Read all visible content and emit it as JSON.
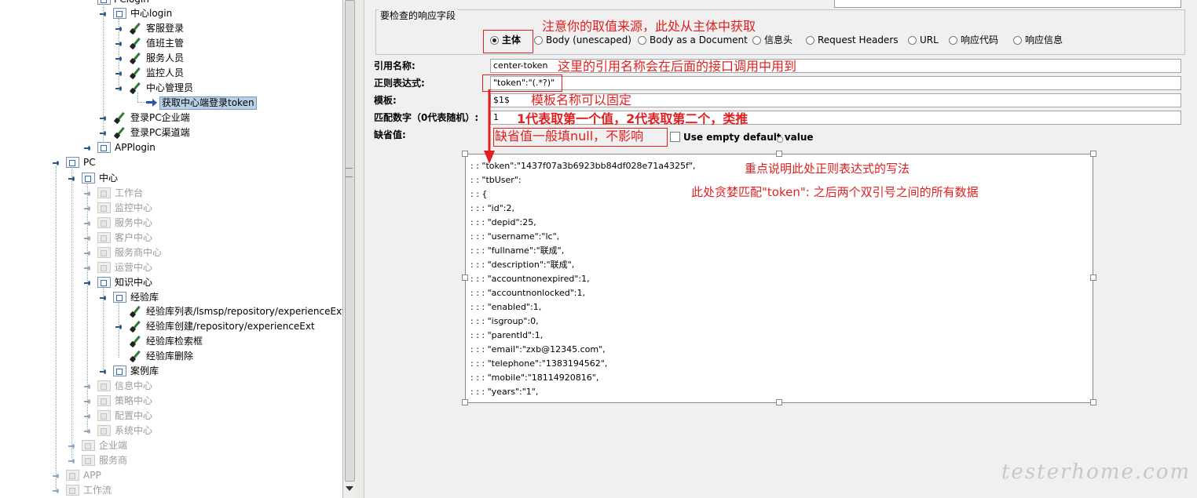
{
  "tree": {
    "nodes": [
      {
        "label": "PClogin",
        "dim": false
      },
      {
        "label": "中心login",
        "dim": false
      },
      {
        "label": "客服登录",
        "dim": false
      },
      {
        "label": "值班主管",
        "dim": false
      },
      {
        "label": "服务人员",
        "dim": false
      },
      {
        "label": "监控人员",
        "dim": false
      },
      {
        "label": "中心管理员",
        "dim": false
      },
      {
        "label": "获取中心端登录token",
        "dim": false,
        "selected": true
      },
      {
        "label": "登录PC企业端",
        "dim": false
      },
      {
        "label": "登录PC渠道端",
        "dim": false
      },
      {
        "label": "APPlogin",
        "dim": false
      },
      {
        "label": "PC",
        "dim": false
      },
      {
        "label": "中心",
        "dim": false
      },
      {
        "label": "工作台",
        "dim": true
      },
      {
        "label": "监控中心",
        "dim": true
      },
      {
        "label": "服务中心",
        "dim": true
      },
      {
        "label": "客户中心",
        "dim": true
      },
      {
        "label": "服务商中心",
        "dim": true
      },
      {
        "label": "运营中心",
        "dim": true
      },
      {
        "label": "知识中心",
        "dim": false
      },
      {
        "label": "经验库",
        "dim": false
      },
      {
        "label": "经验库列表/lsmsp/repository/experienceExt",
        "dim": false
      },
      {
        "label": "经验库创建/repository/experienceExt",
        "dim": false
      },
      {
        "label": "经验库检索框",
        "dim": false
      },
      {
        "label": "经验库删除",
        "dim": false
      },
      {
        "label": "案例库",
        "dim": false
      },
      {
        "label": "信息中心",
        "dim": true
      },
      {
        "label": "策略中心",
        "dim": true
      },
      {
        "label": "配置中心",
        "dim": true
      },
      {
        "label": "系统中心",
        "dim": true
      },
      {
        "label": "企业端",
        "dim": true
      },
      {
        "label": "服务商",
        "dim": true
      },
      {
        "label": "APP",
        "dim": true
      },
      {
        "label": "工作流",
        "dim": true
      }
    ]
  },
  "extractor": {
    "fieldset_title": "要检查的响应字段",
    "radio_options": [
      "主体",
      "Body (unescaped)",
      "Body as a Document",
      "信息头",
      "Request Headers",
      "URL",
      "响应代码",
      "响应信息"
    ],
    "selected_radio": "主体",
    "reference_name_label": "引用名称:",
    "reference_name_value": "center-token",
    "regex_label": "正则表达式:",
    "regex_value": "\"token\":\"(.*?)\"",
    "template_label": "模板:",
    "template_value": "$1$",
    "match_no_label": "匹配数字（0代表随机）:",
    "match_no_value": "1",
    "default_label": "缺省值:",
    "default_empty_label": "Use empty default value"
  },
  "json_sample": [
    ": : \"token\":\"1437f07a3b6923bb84df028e71a4325f\",",
    ": : \"tbUser\":",
    ": : {",
    ": : : \"id\":2,",
    ": : : \"depid\":25,",
    ": : : \"username\":\"lc\",",
    ": : : \"fullname\":\"联成\",",
    ": : : \"description\":\"联成\",",
    ": : : \"accountnonexpired\":1,",
    ": : : \"accountnonlocked\":1,",
    ": : : \"enabled\":1,",
    ": : : \"isgroup\":0,",
    ": : : \"parentId\":1,",
    ": : : \"email\":\"zxb@12345.com\",",
    ": : : \"telephone\":\"1383194562\",",
    ": : : \"mobile\":\"18114920816\",",
    ": : : \"years\":\"1\","
  ],
  "annotations": {
    "source_note": "注意你的取值来源，此处从主体中获取",
    "ref_note": "这里的引用名称会在后面的接口调用中用到",
    "template_note": "模板名称可以固定",
    "match_note": "1代表取第一个值，2代表取第二个，类推",
    "default_note": "缺省值一般填null，不影响",
    "regex_note_1": "重点说明此处正则表达式的写法",
    "regex_note_2": "此处贪婪匹配\"token\": 之后两个双引号之间的所有数据"
  },
  "watermark": "testerhome.com",
  "colors": {
    "annotation": "#e02020",
    "selection": "#b8cfe5"
  }
}
